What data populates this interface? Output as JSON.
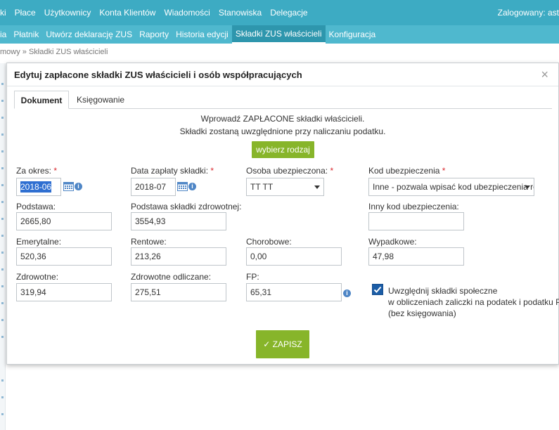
{
  "topnav": {
    "items": [
      "ki",
      "Płace",
      "Użytkownicy",
      "Konta Klientów",
      "Wiadomości",
      "Stanowiska",
      "Delegacje"
    ],
    "login": "Zalogowany: ast"
  },
  "subnav": {
    "items": [
      "ia",
      "Płatnik",
      "Utwórz deklarację ZUS",
      "Raporty",
      "Historia edycji",
      "Składki ZUS właścicieli",
      "Konfiguracja"
    ],
    "active_index": 5
  },
  "breadcrumb": "mowy » Składki ZUS właścicieli",
  "modal": {
    "title": "Edytuj zapłacone składki ZUS właścicieli i osób współpracujących",
    "close": "×",
    "tabs": [
      "Dokument",
      "Księgowanie"
    ],
    "info_line1": "Wprowadź ZAPŁACONE składki właścicieli.",
    "info_line2": "Składki zostaną uwzględnione przy naliczaniu podatku.",
    "choose_button": "wybierz rodzaj",
    "save_button": "✓ ZAPISZ",
    "required_mark": "*",
    "fields": {
      "za_okres": {
        "label": "Za okres:",
        "value": "2018-06"
      },
      "data_zaplaty": {
        "label": "Data zapłaty składki:",
        "value": "2018-07"
      },
      "osoba": {
        "label": "Osoba ubezpieczona:",
        "value": "TT TT"
      },
      "kod": {
        "label": "Kod ubezpieczenia",
        "value": "Inne - pozwala wpisać kod ubezpieczenia ręcznie"
      },
      "podstawa": {
        "label": "Podstawa:",
        "value": "2665,80"
      },
      "podstawa_zdrow": {
        "label": "Podstawa składki zdrowotnej:",
        "value": "3554,93"
      },
      "inny_kod": {
        "label": "Inny kod ubezpieczenia:",
        "value": ""
      },
      "emerytalne": {
        "label": "Emerytalne:",
        "value": "520,36"
      },
      "rentowe": {
        "label": "Rentowe:",
        "value": "213,26"
      },
      "chorobowe": {
        "label": "Chorobowe:",
        "value": "0,00"
      },
      "wypadkowe": {
        "label": "Wypadkowe:",
        "value": "47,98"
      },
      "zdrowotne": {
        "label": "Zdrowotne:",
        "value": "319,94"
      },
      "zdrowotne_odl": {
        "label": "Zdrowotne odliczane:",
        "value": "275,51"
      },
      "fp": {
        "label": "FP:",
        "value": "65,31"
      }
    },
    "checkbox": {
      "checked": true,
      "line1": "Uwzględnij składki społeczne",
      "line2": "w obliczeniach zaliczki na podatek i podatku PIT",
      "line3": "(bez księgowania)"
    }
  },
  "colors": {
    "topnav": "#3dabc3",
    "subnav": "#4fb8ce",
    "accent_green": "#87b52a",
    "required": "#d9262c",
    "checkbox": "#1b5da6"
  },
  "icons": {
    "calendar": "calendar-icon",
    "info": "info-icon",
    "close": "close-icon",
    "dropdown": "chevron-down-icon",
    "check": "check-icon"
  }
}
